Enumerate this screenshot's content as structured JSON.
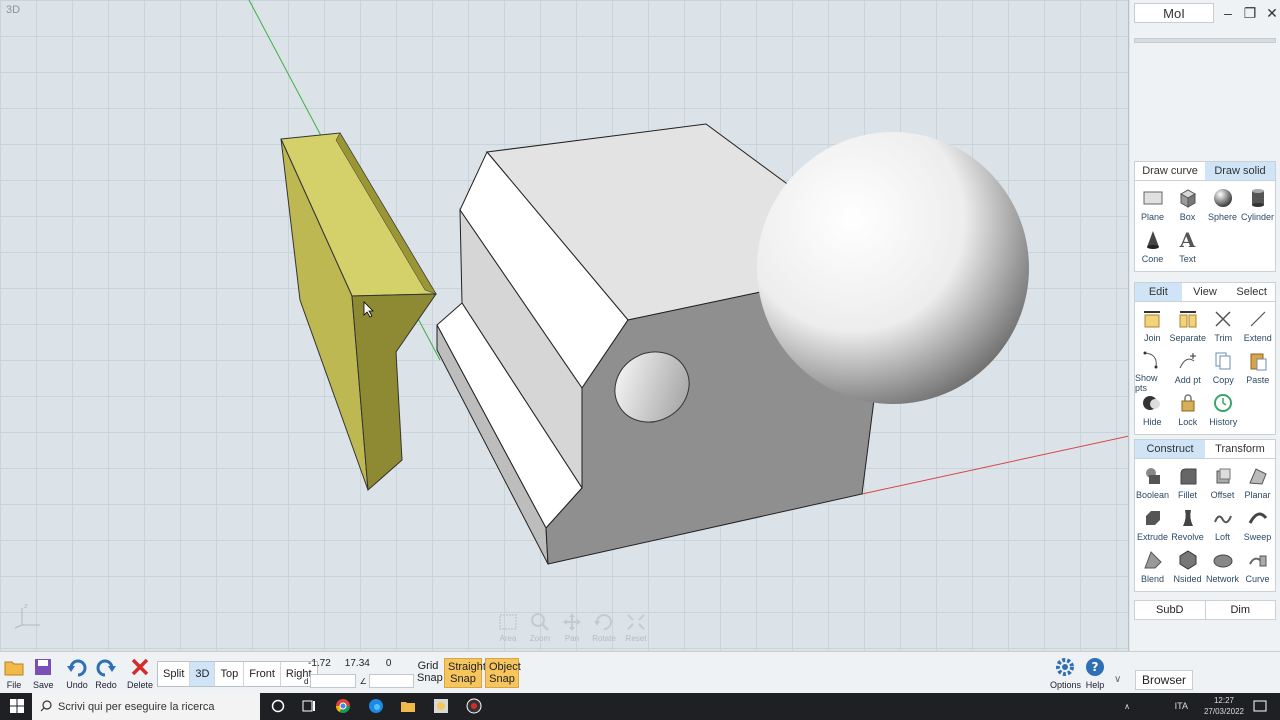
{
  "viewport": {
    "label": "3D",
    "tools": [
      {
        "label": "Area",
        "icon": "area-icon"
      },
      {
        "label": "Zoom",
        "icon": "zoom-icon"
      },
      {
        "label": "Pan",
        "icon": "pan-icon"
      },
      {
        "label": "Rotate",
        "icon": "rotate-icon"
      },
      {
        "label": "Reset",
        "icon": "reset-icon"
      }
    ],
    "colors": {
      "solid_yellow": "#d4d06a",
      "solid_grey": "#8f8f8f",
      "x_axis": "#d64545",
      "y_axis": "#3cb043"
    }
  },
  "panel": {
    "title_button": "MoI",
    "draw_tabs": [
      "Draw curve",
      "Draw solid"
    ],
    "draw_active": "Draw solid",
    "draw_tools": [
      "Plane",
      "Box",
      "Sphere",
      "Cylinder",
      "Cone",
      "Text"
    ],
    "edit_tabs": [
      "Edit",
      "View",
      "Select"
    ],
    "edit_active": "Edit",
    "edit_tools": [
      "Join",
      "Separate",
      "Trim",
      "Extend",
      "Show pts",
      "Add pt",
      "Copy",
      "Paste",
      "Hide",
      "Lock",
      "History"
    ],
    "construct_tabs": [
      "Construct",
      "Transform"
    ],
    "construct_active": "Construct",
    "construct_tools": [
      "Boolean",
      "Fillet",
      "Offset",
      "Planar",
      "Extrude",
      "Revolve",
      "Loft",
      "Sweep",
      "Blend",
      "Nsided",
      "Network",
      "Curve"
    ],
    "footer_tabs": [
      "SubD",
      "Dim"
    ]
  },
  "bottombar": {
    "file": "File",
    "save": "Save",
    "undo": "Undo",
    "redo": "Redo",
    "delete": "Delete",
    "views": [
      "Split",
      "3D",
      "Top",
      "Front",
      "Right"
    ],
    "active_view": "3D",
    "coords": {
      "x": "-1.72",
      "y": "17.34",
      "z": "0",
      "d_label": "d",
      "angle_label": "∠"
    },
    "grid_snap": "Grid Snap",
    "straight_snap": "Straight Snap",
    "object_snap": "Object Snap",
    "options": "Options",
    "help": "Help",
    "browser": "Browser"
  },
  "taskbar": {
    "search_placeholder": "Scrivi qui per eseguire la ricerca",
    "lang": "ITA",
    "time": "12:27",
    "date": "27/03/2022"
  }
}
